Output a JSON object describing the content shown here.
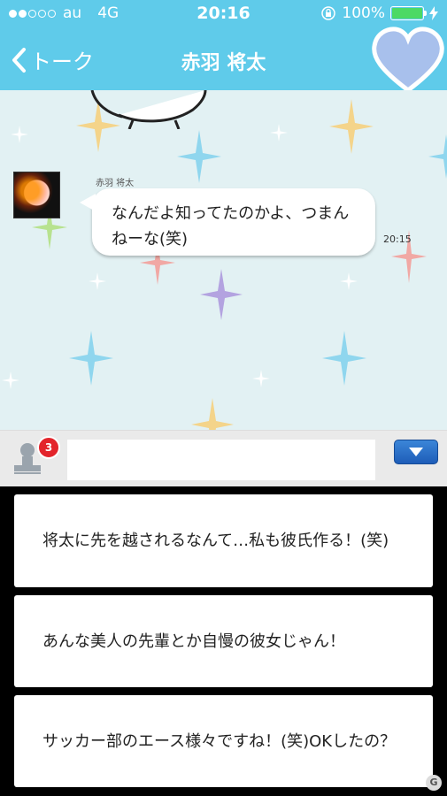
{
  "status_bar": {
    "carrier": "au",
    "network": "4G",
    "time": "20:16",
    "battery": "100%",
    "battery_level": 1.0
  },
  "header": {
    "back_label": "トーク",
    "title": "赤羽 将太"
  },
  "chat": {
    "sender_name": "赤羽 将太",
    "message_text": "なんだよ知ってたのかよ、つまんねーな(笑)",
    "message_time": "20:15"
  },
  "input_bar": {
    "stamp_badge_count": "3",
    "text_value": ""
  },
  "options": [
    {
      "text": "将太に先を越されるなんて…私も彼氏作る！(笑)"
    },
    {
      "text": "あんな美人の先輩とか自慢の彼女じゃん！"
    },
    {
      "text": "サッカー部のエース様々ですね！(笑)OKしたの？"
    }
  ],
  "colors": {
    "theme": "#5fcbea",
    "chat_bg": "#e2f1f3",
    "badge": "#e3242b",
    "send_button": "#2b72c9"
  }
}
